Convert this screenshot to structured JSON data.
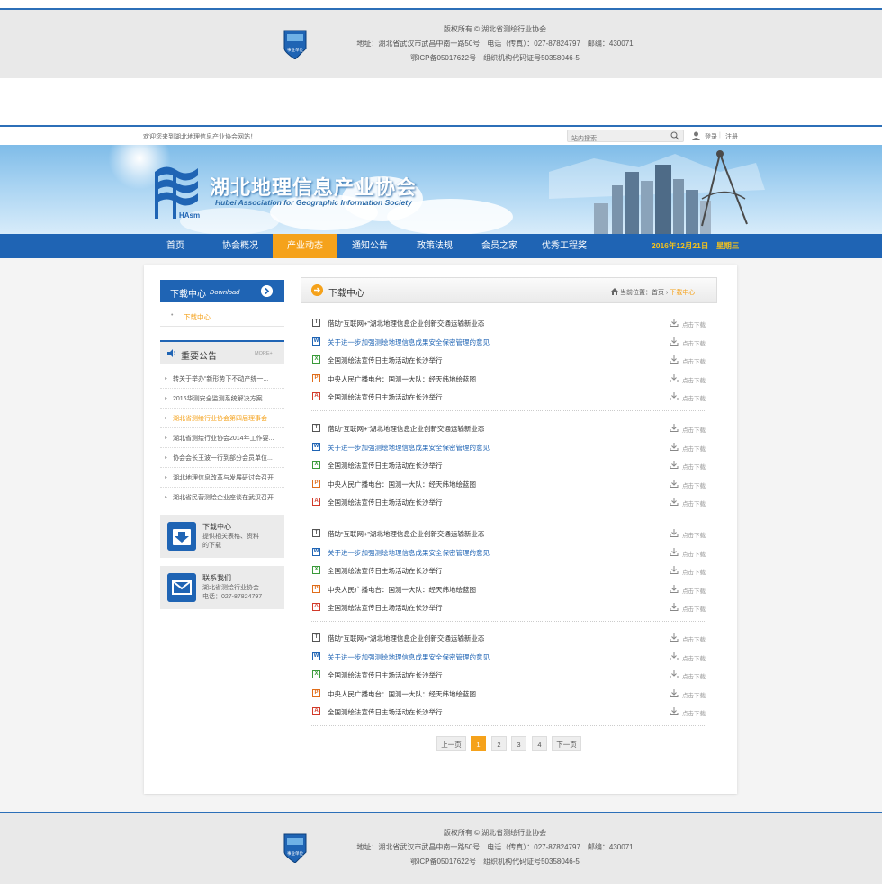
{
  "footer": {
    "copyright": "版权所有 © 湖北省测绘行业协会",
    "address": "地址：湖北省武汉市武昌中南一路50号　电话（传真）：027-87824797　邮编：430071",
    "icp": "鄂ICP备05017622号　组织机构代码证号50358046-5",
    "badge_label": "事业单位"
  },
  "topbar": {
    "welcome": "欢迎您来到湖北地理信息产业协会网站！",
    "search_placeholder": "站内搜索",
    "login": "登录",
    "separator": "|",
    "register": "注册"
  },
  "banner": {
    "title_cn": "湖北地理信息产业协会",
    "title_en": "Hubei Association for Geographic Information Society",
    "logo_text": "HAsm"
  },
  "nav": {
    "items": [
      "首页",
      "协会概况",
      "产业动态",
      "通知公告",
      "政策法规",
      "会员之家",
      "优秀工程奖"
    ],
    "active_index": 2,
    "date": "2016年12月21日　星期三"
  },
  "sidebar": {
    "download_title": "下载中心",
    "download_title_en": "Download",
    "download_sub": "下载中心",
    "notice_title": "重要公告",
    "notice_more": "MORE+",
    "notices": [
      "转关于举办“新形势下不动产统一...",
      "2016华测安全监测系统解决方案",
      "湖北省测绘行业协会第四届理事会",
      "湖北省测绘行业协会2014年工作要...",
      "协会会长王波一行到部分会员单位...",
      "湖北地理信息改革与发展研讨会召开",
      "湖北省民营测绘企业座谈在武汉召开"
    ],
    "notice_highlight": 2,
    "box_download": {
      "title": "下载中心",
      "desc1": "提供相关表格、资料",
      "desc2": "的下载"
    },
    "box_contact": {
      "title": "联系我们",
      "desc1": "湖北省测绘行业协会",
      "desc2": "电话：027-87824797"
    }
  },
  "main": {
    "title": "下载中心",
    "crumb_label": "当前位置：",
    "crumb_home": "首页",
    "crumb_arrow": "›",
    "crumb_current": "下载中心",
    "download_label": "点击下载",
    "file_types": [
      "T",
      "W",
      "X",
      "P",
      "A"
    ],
    "rows": [
      "借助“互联网+”湖北地理信息企业创新交通运输新业态",
      "关于进一步加强测绘地理信息成果安全保密管理的意见",
      "全国测绘法宣传日主场活动在长沙举行",
      "中央人民广播电台：国测一大队：经天纬地绘蓝图",
      "全国测绘法宣传日主场活动在长沙举行"
    ],
    "pager": {
      "prev": "上一页",
      "pages": [
        "1",
        "2",
        "3",
        "4"
      ],
      "current": "1",
      "next": "下一页"
    }
  }
}
